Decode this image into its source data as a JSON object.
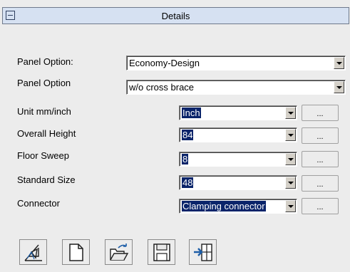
{
  "panel": {
    "title": "Details"
  },
  "fields": [
    {
      "label": "Panel Option:",
      "value": "Economy-Design",
      "selected": false
    },
    {
      "label": "Panel Option",
      "value": "w/o cross brace",
      "selected": false
    },
    {
      "label": "Unit mm/inch",
      "value": "Inch",
      "selected": true,
      "button": "..."
    },
    {
      "label": "Overall Height",
      "value": "84",
      "selected": true,
      "button": "..."
    },
    {
      "label": "Floor Sweep",
      "value": "8",
      "selected": true,
      "button": "..."
    },
    {
      "label": "Standard Size",
      "value": "48",
      "selected": true,
      "button": "..."
    },
    {
      "label": "Connector",
      "value": "Clamping connector",
      "selected": true,
      "button": "..."
    }
  ],
  "toolbar": {
    "buttons": [
      {
        "icon": "drawing-icon"
      },
      {
        "icon": "new-document-icon"
      },
      {
        "icon": "open-folder-icon"
      },
      {
        "icon": "save-disk-icon"
      },
      {
        "icon": "exit-icon"
      }
    ]
  },
  "colors": {
    "title_bar": "#d6e1f2",
    "selection": "#0a246a",
    "icon_blue": "#1f5fa8"
  }
}
